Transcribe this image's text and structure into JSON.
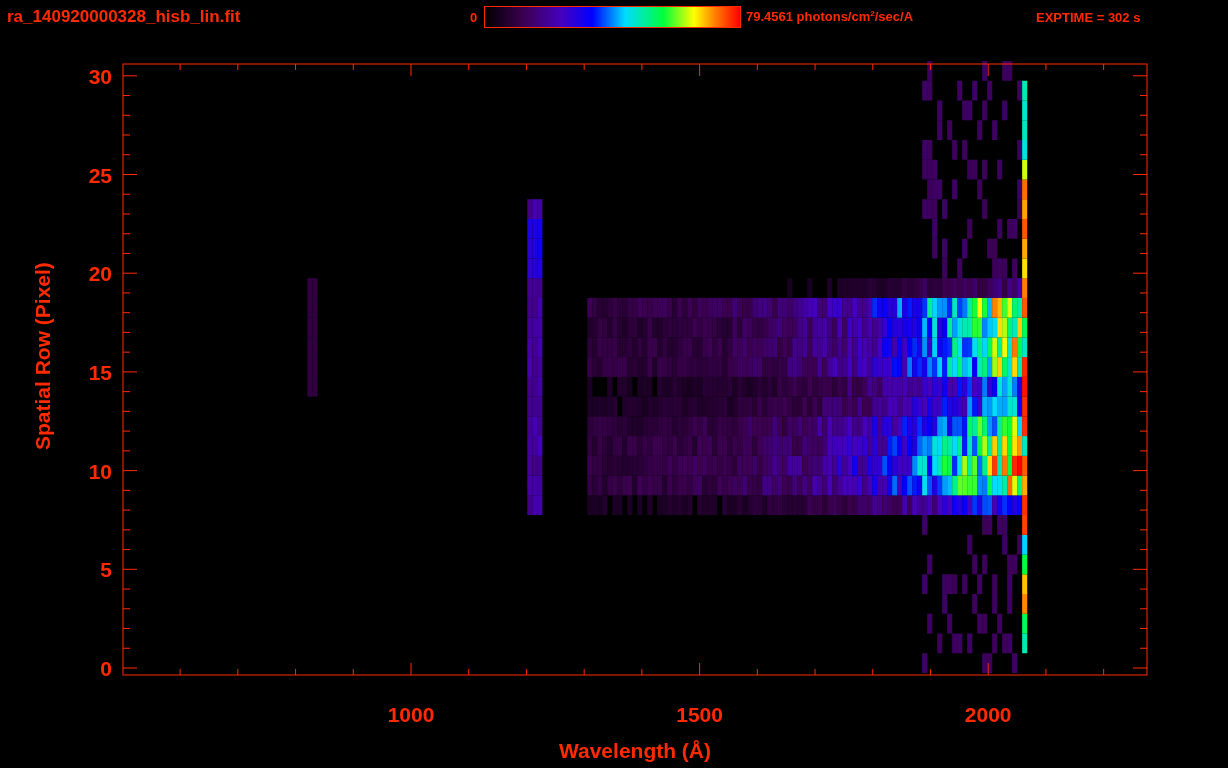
{
  "header": {
    "filename": "ra_140920000328_hisb_lin.fit",
    "colorbar": {
      "min_label": "0",
      "max_label": "79.4561 photons/cm$^{2}$/sec/A"
    },
    "exposure": "EXPTIME = 302 s"
  },
  "plot": {
    "xlabel": "Wavelength (Å)",
    "ylabel": "Spatial Row (Pixel)",
    "xticks": [
      "1000",
      "1500",
      "2000"
    ],
    "yticks": [
      "30",
      "25",
      "20",
      "15",
      "10",
      "5",
      "0"
    ]
  }
}
